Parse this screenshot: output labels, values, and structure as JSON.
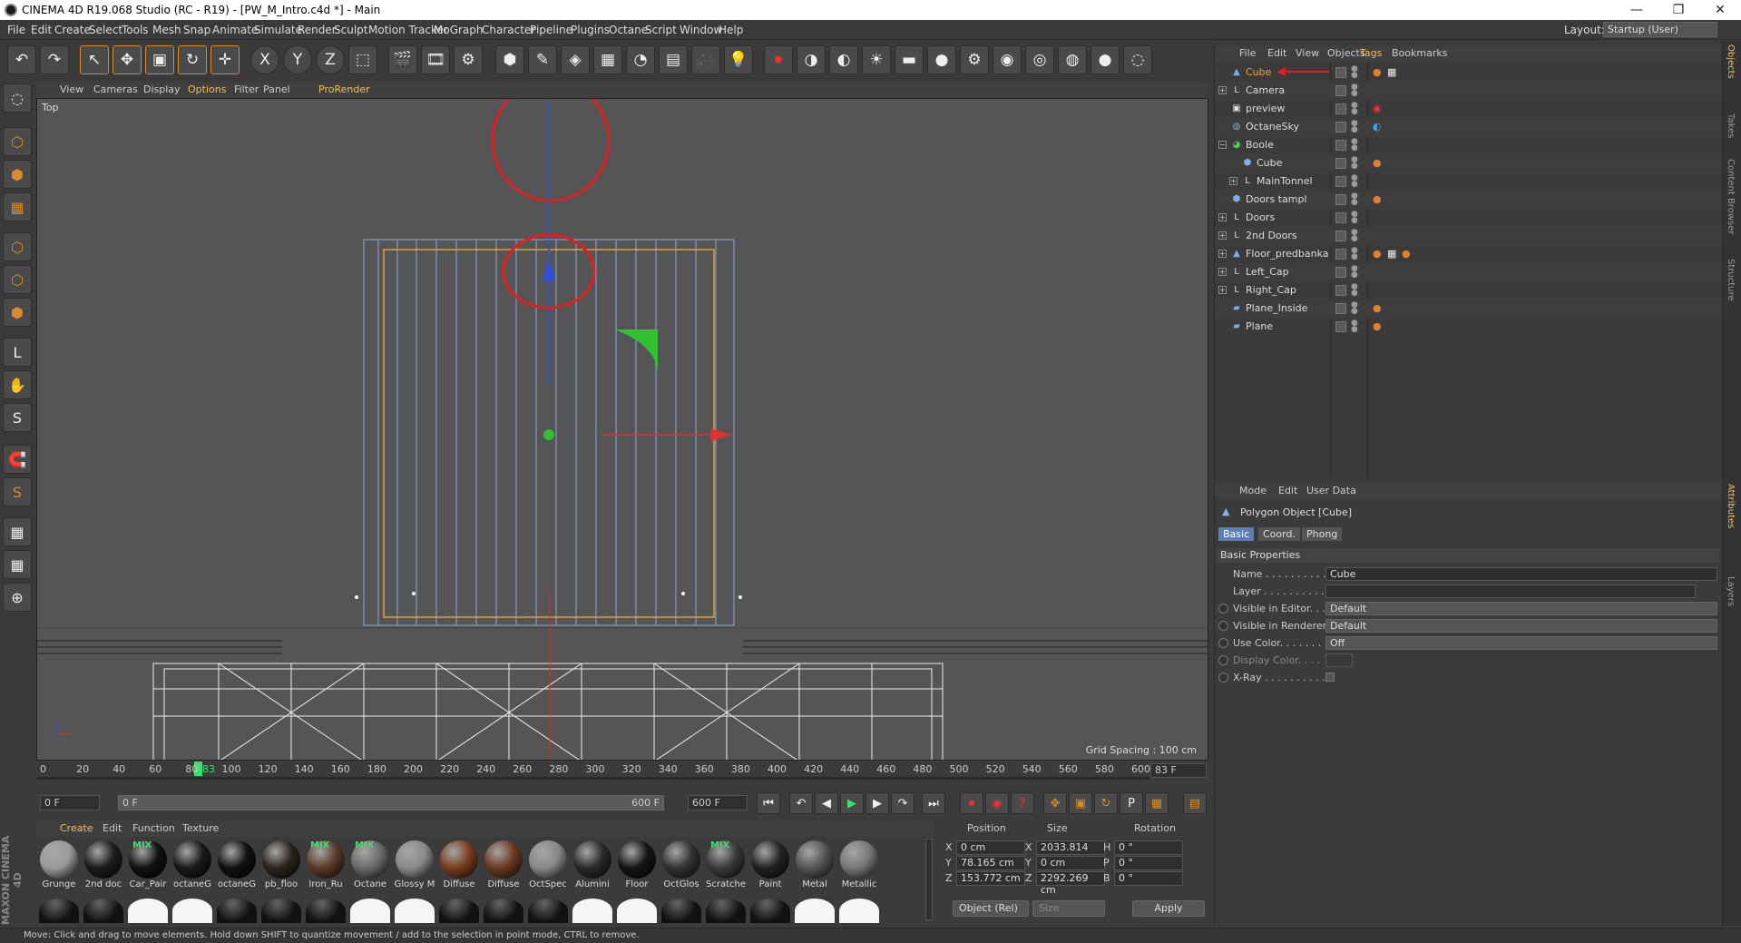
{
  "titlebar": {
    "title": "CINEMA 4D R19.068 Studio (RC - R19) - [PW_M_Intro.c4d *] - Main",
    "minimize": "—",
    "maximize": "❐",
    "close": "✕"
  },
  "menu": [
    "File",
    "Edit",
    "Create",
    "Select",
    "Tools",
    "Mesh",
    "Snap",
    "Animate",
    "Simulate",
    "Render",
    "Sculpt",
    "Motion Tracker",
    "MoGraph",
    "Character",
    "Pipeline",
    "Plugins",
    "Octane",
    "Script",
    "Window",
    "Help"
  ],
  "layout": {
    "label": "Layout:",
    "value": "Startup (User)"
  },
  "toolbar": {
    "icons": [
      "undo-icon",
      "redo-icon",
      "select-icon",
      "move-icon",
      "scale-icon",
      "rotate-icon",
      "recent-tool-icon",
      "x-axis-icon",
      "y-axis-icon",
      "z-axis-icon",
      "coordinate-system-icon",
      "render-view-icon",
      "render-pictureviewer-icon",
      "render-settings-icon",
      "cube-primitive-icon",
      "spline-pen-icon",
      "subdivision-icon",
      "array-icon",
      "deformer-icon",
      "floor-icon",
      "camera-icon",
      "light-icon",
      "octane-render-icon",
      "octane-livewindow-icon",
      "octane-sky-icon",
      "octane-sun-icon",
      "octane-plane-icon",
      "octane-fur-icon",
      "octane-gear-icon",
      "octane-sphere-icon",
      "octane-glass-icon",
      "octane-checker-icon",
      "octane-metal-icon",
      "octane-extra-icon"
    ],
    "glyphs": [
      "↶",
      "↷",
      "↖",
      "✥",
      "▣",
      "↻",
      "✛",
      "X",
      "Y",
      "Z",
      "⬚",
      "🎬",
      "🎞",
      "⚙",
      "⬢",
      "✎",
      "◈",
      "▦",
      "◔",
      "▤",
      "🎥",
      "💡",
      "⏺",
      "◑",
      "◐",
      "☀",
      "▬",
      "●",
      "⚙",
      "◉",
      "◎",
      "◍",
      "●",
      "◌"
    ]
  },
  "lefttools": {
    "icons": [
      "layout-icon",
      "model-mode-icon",
      "texture-mode-icon",
      "workplane-icon",
      "point-mode-icon",
      "edge-mode-icon",
      "polygon-mode-icon",
      "axis-mode-icon",
      "tweak-icon",
      "sculpt-s-icon",
      "magnet-icon",
      "snap-icon",
      "grid-snap-icon",
      "grid-snap2-icon",
      "xyz-lock-icon"
    ],
    "glyphs": [
      "◌",
      "⬡",
      "⬢",
      "▦",
      "⬡",
      "⬡",
      "⬢",
      "L",
      "✋",
      "S",
      "🧲",
      "S",
      "▦",
      "▦",
      "⊕"
    ]
  },
  "viewport": {
    "menu": [
      "View",
      "Cameras",
      "Display",
      "Options",
      "Filter",
      "Panel",
      "ProRender"
    ],
    "label": "Top",
    "grid_spacing": "Grid Spacing : 100 cm"
  },
  "timeline": {
    "ticks": [
      "0",
      "20",
      "40",
      "60",
      "80",
      "100",
      "120",
      "140",
      "160",
      "180",
      "200",
      "220",
      "240",
      "260",
      "280",
      "300",
      "320",
      "340",
      "360",
      "380",
      "400",
      "420",
      "440",
      "460",
      "480",
      "500",
      "520",
      "540",
      "560",
      "580",
      "600"
    ],
    "current": "83",
    "frame_field": "83 F"
  },
  "playbar": {
    "start": "0 F",
    "range_start": "0 F",
    "range_end": "600 F",
    "end": "600 F"
  },
  "materials": {
    "menu": [
      "Create",
      "Edit",
      "Function",
      "Texture"
    ],
    "items": [
      {
        "label": "Grunge",
        "color": "#9a9a9a",
        "mix": ""
      },
      {
        "label": "2nd doc",
        "color": "#1c1c1c",
        "mix": ""
      },
      {
        "label": "Car_Pair",
        "color": "#111",
        "mix": "MIX"
      },
      {
        "label": "octaneG",
        "color": "#1a1a1a",
        "mix": ""
      },
      {
        "label": "octaneG",
        "color": "#111",
        "mix": ""
      },
      {
        "label": "pb_floo",
        "color": "#2a241c",
        "mix": ""
      },
      {
        "label": "Iron_Ru",
        "color": "#5a3a2a",
        "mix": "MIX"
      },
      {
        "label": "Octane",
        "color": "#6a6a6a",
        "mix": "MIX"
      },
      {
        "label": "Glossy M",
        "color": "#8a8a8a",
        "mix": ""
      },
      {
        "label": "Diffuse",
        "color": "#7a3d1d",
        "mix": ""
      },
      {
        "label": "Diffuse",
        "color": "#6a3a22",
        "mix": ""
      },
      {
        "label": "OctSpec",
        "color": "#888",
        "mix": ""
      },
      {
        "label": "Alumini",
        "color": "#2a2a2a",
        "mix": ""
      },
      {
        "label": "Floor",
        "color": "#151515",
        "mix": ""
      },
      {
        "label": "OctGlos",
        "color": "#333",
        "mix": ""
      },
      {
        "label": "Scratche",
        "color": "#3a3a3a",
        "mix": "MIX"
      },
      {
        "label": "Paint",
        "color": "#222",
        "mix": ""
      },
      {
        "label": "Metal",
        "color": "#555",
        "mix": ""
      },
      {
        "label": "Metallic",
        "color": "#777",
        "mix": ""
      }
    ]
  },
  "coords": {
    "headers": [
      "Position",
      "Size",
      "Rotation"
    ],
    "pos": [
      {
        "l": "X",
        "v": "0 cm"
      },
      {
        "l": "Y",
        "v": "78.165 cm"
      },
      {
        "l": "Z",
        "v": "153.772 cm"
      }
    ],
    "size": [
      {
        "l": "X",
        "v": "2033.814 cm"
      },
      {
        "l": "Y",
        "v": "0 cm"
      },
      {
        "l": "Z",
        "v": "2292.269 cm"
      }
    ],
    "rot": [
      {
        "l": "H",
        "v": "0 °"
      },
      {
        "l": "P",
        "v": "0 °"
      },
      {
        "l": "B",
        "v": "0 °"
      }
    ],
    "mode": "Object (Rel)",
    "size_mode": "Size",
    "apply": "Apply"
  },
  "status": "Move: Click and drag to move elements. Hold down SHIFT to quantize movement / add to the selection in point mode, CTRL to remove.",
  "maxon": "MAXON CINEMA 4D",
  "objects": {
    "menu": [
      "File",
      "Edit",
      "View",
      "Objects",
      "Tags",
      "Bookmarks"
    ],
    "rows": [
      {
        "name": "Cube",
        "indent": 0,
        "icon": "polygon-icon",
        "glyph": "▲",
        "color": "#7fb0e8",
        "exp": "",
        "selected": true,
        "tags": "●▦"
      },
      {
        "name": "Camera",
        "indent": 0,
        "icon": "null-icon",
        "glyph": "L",
        "color": "#ddd",
        "exp": "+",
        "tags": ""
      },
      {
        "name": "preview",
        "indent": 0,
        "icon": "camera-icon",
        "glyph": "▣",
        "color": "#ddd",
        "exp": "",
        "tags": "◉"
      },
      {
        "name": "OctaneSky",
        "indent": 0,
        "icon": "sky-icon",
        "glyph": "◍",
        "color": "#8ab",
        "exp": "",
        "tags": "◐"
      },
      {
        "name": "Boole",
        "indent": 0,
        "icon": "boole-icon",
        "glyph": "◕",
        "color": "#5c5",
        "exp": "−",
        "tags": ""
      },
      {
        "name": "Cube",
        "indent": 1,
        "icon": "polygon-icon",
        "glyph": "⬢",
        "color": "#7fb0e8",
        "exp": "",
        "tags": "●"
      },
      {
        "name": "MainTonnel",
        "indent": 1,
        "icon": "null-icon",
        "glyph": "L",
        "color": "#ddd",
        "exp": "+",
        "tags": ""
      },
      {
        "name": "Doors tampl",
        "indent": 0,
        "icon": "polygon-icon",
        "glyph": "⬢",
        "color": "#7fb0e8",
        "exp": "",
        "tags": "●"
      },
      {
        "name": "Doors",
        "indent": 0,
        "icon": "null-icon",
        "glyph": "L",
        "color": "#ddd",
        "exp": "+",
        "tags": ""
      },
      {
        "name": "2nd Doors",
        "indent": 0,
        "icon": "null-icon",
        "glyph": "L",
        "color": "#ddd",
        "exp": "+",
        "tags": ""
      },
      {
        "name": "Floor_predbanka",
        "indent": 0,
        "icon": "polygon-icon",
        "glyph": "▲",
        "color": "#7fb0e8",
        "exp": "+",
        "tags": "●▦●"
      },
      {
        "name": "Left_Cap",
        "indent": 0,
        "icon": "null-icon",
        "glyph": "L",
        "color": "#ddd",
        "exp": "+",
        "tags": ""
      },
      {
        "name": "Right_Cap",
        "indent": 0,
        "icon": "null-icon",
        "glyph": "L",
        "color": "#ddd",
        "exp": "+",
        "tags": ""
      },
      {
        "name": "Plane_Inside",
        "indent": 0,
        "icon": "plane-icon",
        "glyph": "▰",
        "color": "#7fb0e8",
        "exp": "",
        "tags": "●"
      },
      {
        "name": "Plane",
        "indent": 0,
        "icon": "plane-icon",
        "glyph": "▰",
        "color": "#7fb0e8",
        "exp": "",
        "tags": "●"
      }
    ]
  },
  "attributes": {
    "menu": [
      "Mode",
      "Edit",
      "User Data"
    ],
    "title": "Polygon Object [Cube]",
    "tabs": [
      "Basic",
      "Coord.",
      "Phong"
    ],
    "section": "Basic Properties",
    "rows": [
      {
        "label": "Name . . . . . . . . . . . .",
        "value": "Cube",
        "radio": false
      },
      {
        "label": "Layer . . . . . . . . . . . .",
        "value": "",
        "radio": false
      },
      {
        "label": "Visible in Editor. . .",
        "value": "Default",
        "radio": true
      },
      {
        "label": "Visible in Renderer",
        "value": "Default",
        "radio": true
      },
      {
        "label": "Use Color. . . . . . . . .",
        "value": "Off",
        "radio": true
      },
      {
        "label": "Display Color. . . .",
        "value": "",
        "radio": true
      },
      {
        "label": "X-Ray . . . . . . . . . . .",
        "value": "",
        "radio": true
      }
    ]
  },
  "rightstrip": [
    "Objects",
    "Takes",
    "Content Browser",
    "Structure",
    "Attributes",
    "Layers"
  ],
  "colors": {
    "accent": "#d88b2a",
    "annotation": "#e02020",
    "axis_x": "#e03030",
    "axis_y": "#3050e0",
    "axis_z": "#30c030",
    "wire": "#8aa7d8",
    "cube_edge": "#e0a040"
  }
}
